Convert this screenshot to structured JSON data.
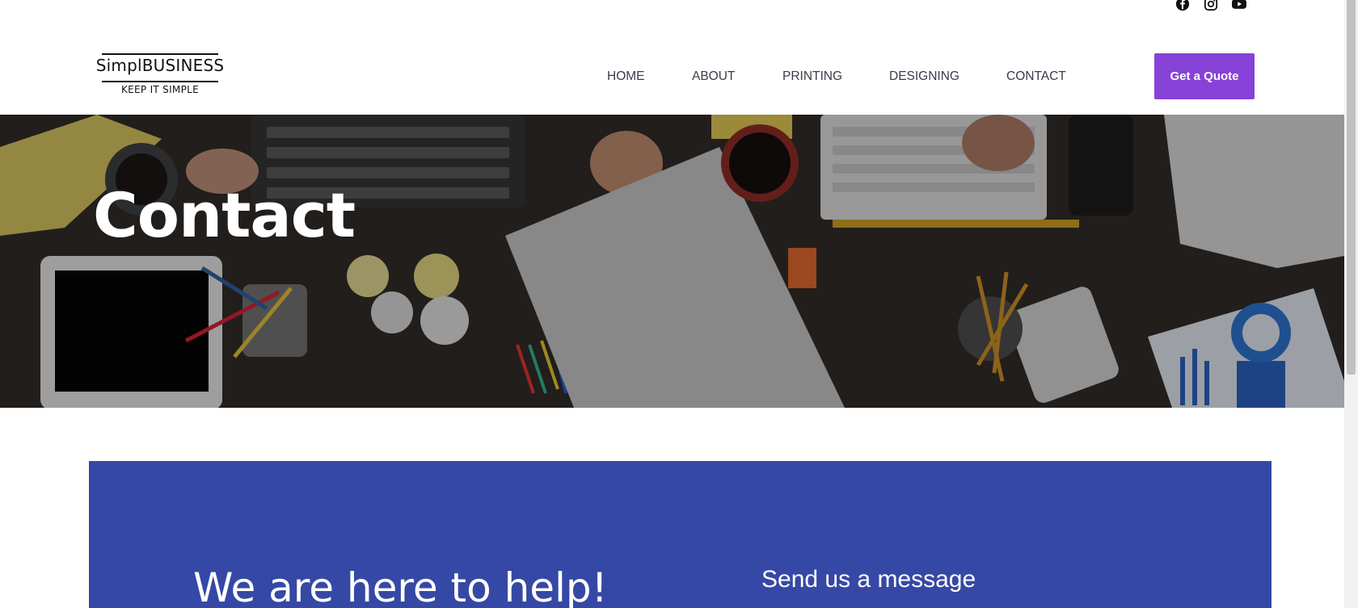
{
  "social": [
    "facebook-icon",
    "instagram-icon",
    "youtube-icon"
  ],
  "brand": {
    "name": "SimplBUSINESS",
    "tagline": "KEEP IT SIMPLE"
  },
  "nav": [
    "HOME",
    "ABOUT",
    "PRINTING",
    "DESIGNING",
    "CONTACT"
  ],
  "cta": {
    "label": "Get a Quote",
    "color": "#8742d8"
  },
  "hero": {
    "title": "Contact"
  },
  "section": {
    "heading": "We are here to help!",
    "form_title": "Send us a message",
    "background": "#3648a5"
  }
}
